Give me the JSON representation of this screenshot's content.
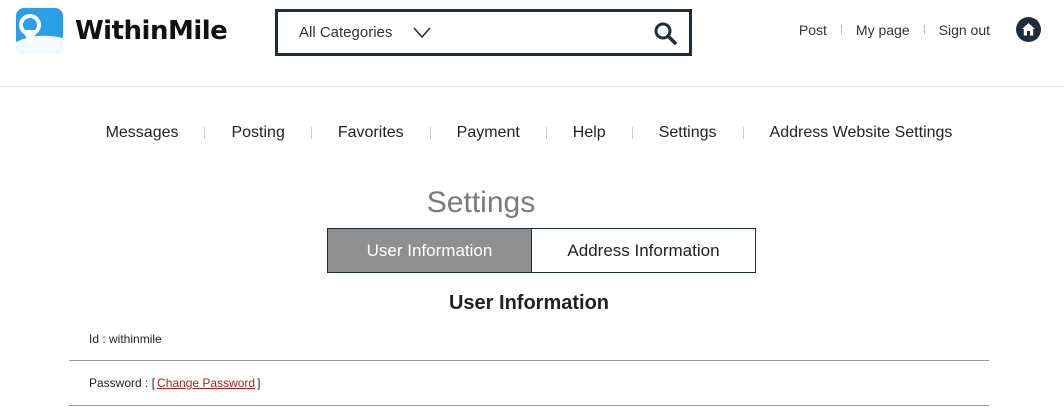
{
  "brand": {
    "name": "WithinMile"
  },
  "search": {
    "category": "All Categories"
  },
  "top_links": {
    "post": "Post",
    "my_page": "My page",
    "sign_out": "Sign out"
  },
  "nav": {
    "items": [
      {
        "label": "Messages"
      },
      {
        "label": "Posting"
      },
      {
        "label": "Favorites"
      },
      {
        "label": "Payment"
      },
      {
        "label": "Help"
      },
      {
        "label": "Settings"
      },
      {
        "label": "Address Website Settings"
      }
    ]
  },
  "settings": {
    "title": "Settings",
    "tabs": [
      {
        "label": "User Information",
        "active": true
      },
      {
        "label": "Address Information",
        "active": false
      }
    ],
    "section_title": "User Information",
    "id_label": "Id : ",
    "id_value": "withinmile",
    "password_label": "Password : [",
    "password_close": "]",
    "change_password": "Change Password"
  },
  "colors": {
    "accent": "#2a9ee8",
    "dark": "#1f2d3a",
    "active_tab": "#8f8f8f",
    "link": "#b01e1e"
  },
  "icons": {
    "logo": "map-pin-icon",
    "search": "search-icon",
    "home": "home-icon",
    "dropdown": "chevron-down-icon"
  }
}
